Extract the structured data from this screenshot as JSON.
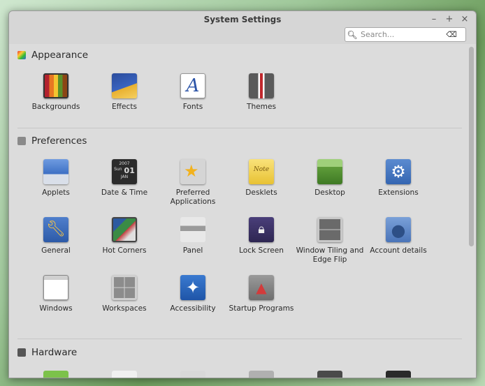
{
  "window": {
    "title": "System Settings",
    "minimize": "–",
    "maximize": "+",
    "close": "×"
  },
  "search": {
    "placeholder": "Search..."
  },
  "sections": {
    "appearance": {
      "title": "Appearance",
      "items": [
        "Backgrounds",
        "Effects",
        "Fonts",
        "Themes"
      ],
      "font_glyph": "A"
    },
    "preferences": {
      "title": "Preferences",
      "row1": [
        "Applets",
        "Date & Time",
        "Preferred Applications",
        "Desklets",
        "Desktop",
        "Extensions"
      ],
      "row2": [
        "General",
        "Hot Corners",
        "Panel",
        "Lock Screen",
        "Window Tiling and Edge Flip",
        "Account details"
      ],
      "row3": [
        "Windows",
        "Workspaces",
        "Accessibility",
        "Startup Programs"
      ],
      "datetime_year": "2007",
      "datetime_day": "Sun",
      "datetime_date": "01",
      "datetime_month": "JAN",
      "desklet_note": "Note"
    },
    "hardware": {
      "title": "Hardware"
    }
  }
}
